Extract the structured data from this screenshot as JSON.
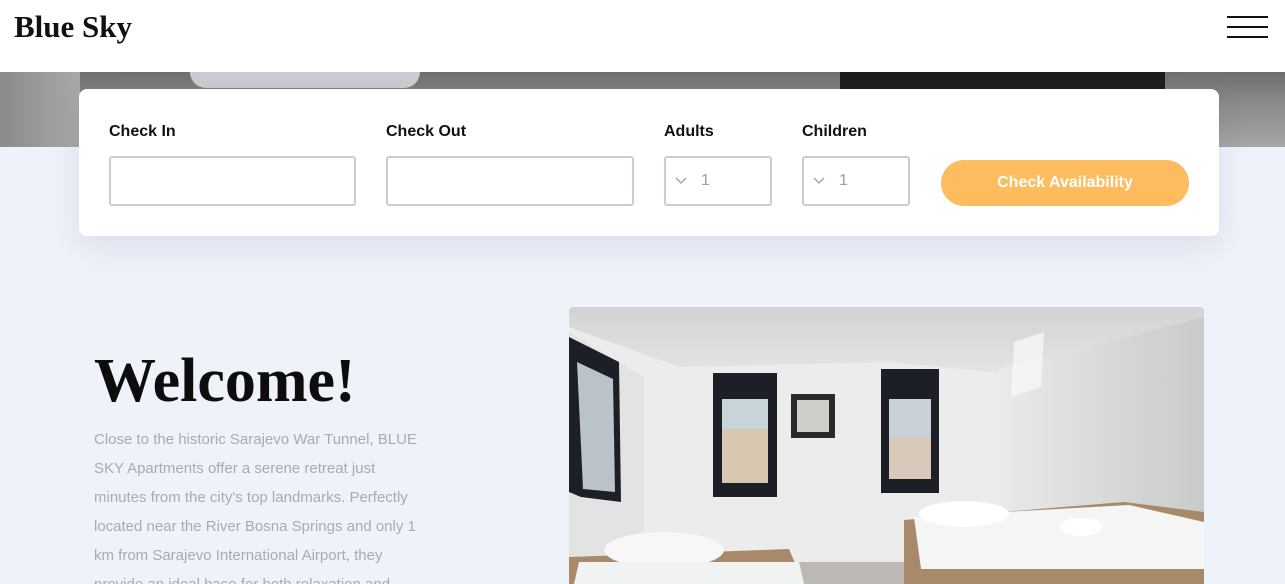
{
  "header": {
    "brand": "Blue Sky",
    "menu_icon": "hamburger-menu-icon"
  },
  "booking": {
    "check_in_label": "Check In",
    "check_out_label": "Check Out",
    "adults_label": "Adults",
    "adults_value": "1",
    "children_label": "Children",
    "children_value": "1",
    "chevron_icon": "chevron-down-icon",
    "button_label": "Check Availability",
    "button_color": "#fdbd5e"
  },
  "welcome": {
    "title": "Welcome!",
    "text": "Close to the historic Sarajevo War Tunnel, BLUE SKY Apartments offer a serene retreat just minutes from the city's top landmarks. Perfectly located near the River Bosna Springs and only 1 km from Sarajevo International Airport, they provide an ideal base for both relaxation and"
  },
  "colors": {
    "page_background": "#eef2f9",
    "accent": "#fdbd5e"
  }
}
